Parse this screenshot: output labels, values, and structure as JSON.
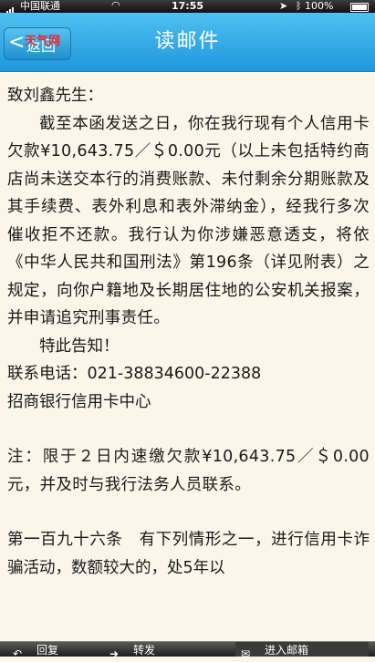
{
  "status_bar": {
    "carrier": "中国联通",
    "wifi_icon": "wifi-icon",
    "time": "17:55",
    "battery": "100%"
  },
  "nav": {
    "back_label": "返回",
    "title": "读邮件",
    "watermark": "天气网"
  },
  "letter": {
    "salutation": "致刘鑫先生：",
    "body_1": "截至本函发送之日，你在我行现有个人信用卡欠款¥10,643.75／＄0.00元（以上未包括特约商店尚未送交本行的消费账款、未付剩余分期账款及其手续费、表外利息和表外滞纳金），经我行多次催收拒不还款。我行认为你涉嫌恶意透支，将依《中华人民共和国刑法》第196条（详见附表）之规定，向你户籍地及长期居住地的公安机关报案，并申请追究刑事责任。",
    "notice": "特此告知！",
    "contact": "联系电话：021-38834600-22388",
    "sender": "招商银行信用卡中心",
    "note": "注：限于２日内速缴欠款¥10,643.75／＄0.00元，并及时与我行法务人员联系。",
    "statute": "第一百九十六条　有下列情形之一，进行信用卡诈骗活动，数额较大的，处5年以"
  },
  "tab_bar": {
    "reply": "回复",
    "forward": "转发",
    "inbox": "进入邮箱"
  }
}
